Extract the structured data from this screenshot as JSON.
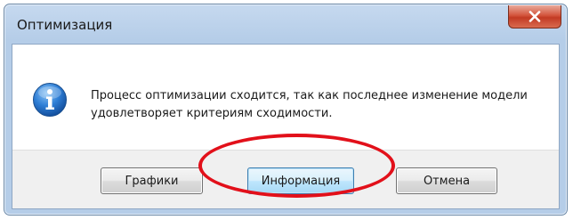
{
  "window": {
    "title": "Оптимизация",
    "close_icon": "close-icon"
  },
  "dialog": {
    "icon": "info-icon",
    "message": "Процесс оптимизации сходится, так как последнее изменение модели удовлетворяет критериям сходимости."
  },
  "buttons": {
    "graphs_label": "Графики",
    "info_label": "Информация",
    "cancel_label": "Отмена",
    "default": "info"
  },
  "colors": {
    "annotation": "#e2101a",
    "close_button": "#c23a23",
    "title_bar": "#b5cde8"
  }
}
